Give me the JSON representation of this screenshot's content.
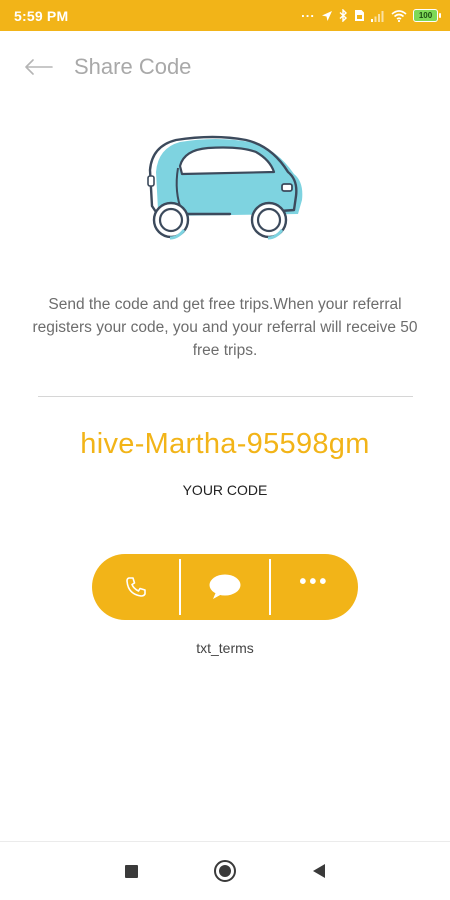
{
  "status_bar": {
    "time": "5:59 PM",
    "overflow_dots": "...",
    "battery_level": "100",
    "background": "#f2b418"
  },
  "toolbar": {
    "back_icon": "arrow-left-icon",
    "title": "Share Code"
  },
  "illustration": {
    "icon": "car-icon",
    "body_color": "#7ed3e0",
    "outline_color": "#3c4a5c"
  },
  "description": "Send the code and get free trips.When your referral registers your code, you and your referral will receive 50 free trips.",
  "referral": {
    "code": "hive-Martha-95598gm",
    "caption": "YOUR CODE"
  },
  "share_actions": [
    {
      "name": "phone",
      "icon": "phone-icon"
    },
    {
      "name": "message",
      "icon": "chat-bubble-icon"
    },
    {
      "name": "more",
      "icon": "more-horizontal-icon",
      "label": "•••"
    }
  ],
  "terms_label": "txt_terms",
  "colors": {
    "accent": "#f2b418",
    "title_gray": "#a9a9a9",
    "text_gray": "#6d6d6d"
  },
  "nav_bar": {
    "buttons": [
      "recents-icon",
      "home-icon",
      "back-triangle-icon"
    ]
  }
}
